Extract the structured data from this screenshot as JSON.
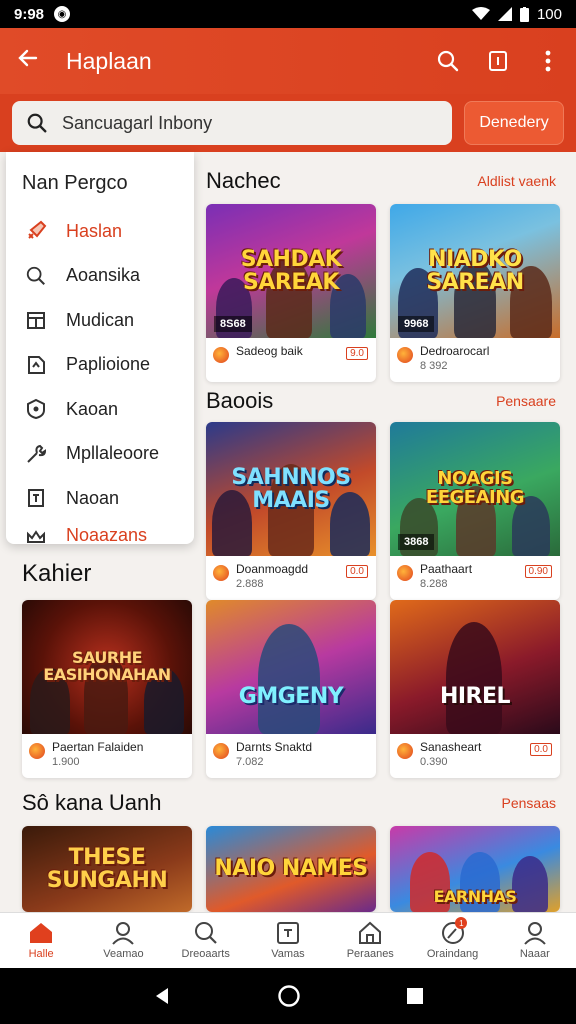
{
  "status": {
    "time": "9:98",
    "battery": "100"
  },
  "appbar": {
    "title": "Haplaan"
  },
  "search": {
    "placeholder": "Sancuagarl Inbony",
    "button_label": "Denedery"
  },
  "drawer": {
    "title": "Nan Pergco",
    "items": [
      {
        "label": "Haslan",
        "icon": "rocket-icon",
        "active": true
      },
      {
        "label": "Aoansika",
        "icon": "search-icon"
      },
      {
        "label": "Mudican",
        "icon": "store-icon"
      },
      {
        "label": "Paplioione",
        "icon": "tag-icon"
      },
      {
        "label": "Kaoan",
        "icon": "shield-icon"
      },
      {
        "label": "Mpllaleoore",
        "icon": "wrench-icon"
      },
      {
        "label": "Naoan",
        "icon": "book-icon"
      },
      {
        "label": "Noaazans",
        "icon": "crown-icon"
      }
    ]
  },
  "sections": [
    {
      "title": "Nachec",
      "more": "Aldlist vaenk",
      "cards": [
        {
          "art_title": "SAHDAK SAREAK",
          "badge": "8S68",
          "name": "Sadeog baik",
          "sub": "",
          "tag": "9.0"
        },
        {
          "art_title": "NIADKO SAREAN",
          "badge": "9968",
          "name": "Dedroarocarl",
          "sub": "8 392",
          "tag": ""
        }
      ]
    },
    {
      "title": "Baoois",
      "more": "Pensaare",
      "cards": [
        {
          "art_title": "SAHNNOS MAAIS",
          "badge": "",
          "name": "Doanmoagdd",
          "sub": "2.888",
          "tag": "0.0"
        },
        {
          "art_title": "NOAGIS EEGEAING",
          "badge": "3868",
          "name": "Paathaart",
          "sub": "8.288",
          "tag": "0.90"
        }
      ]
    },
    {
      "title": "Kahier",
      "more": "",
      "cards": [
        {
          "art_title": "SAURHE EASIHONAHAN",
          "badge": "",
          "name": "Paertan Falaiden",
          "sub": "1.900",
          "tag": ""
        },
        {
          "art_title": "GMGENY",
          "badge": "",
          "name": "Darnts Snaktd",
          "sub": "7.082",
          "tag": ""
        },
        {
          "art_title": "HIREL",
          "badge": "",
          "name": "Sanasheart",
          "sub": "0.390",
          "tag": "0.0"
        }
      ]
    },
    {
      "title": "Sô kana Uanh",
      "more": "Pensaas",
      "cards": [
        {
          "art_title": "THESE SUNGAHN",
          "badge": "",
          "name": "",
          "sub": "",
          "tag": ""
        },
        {
          "art_title": "NAIO NAMES",
          "badge": "",
          "name": "",
          "sub": "",
          "tag": ""
        },
        {
          "art_title": "EARNHAS",
          "badge": "",
          "name": "",
          "sub": "",
          "tag": ""
        }
      ]
    }
  ],
  "bottom_nav": [
    {
      "label": "Halle",
      "icon": "home-icon",
      "active": true
    },
    {
      "label": "Veamao",
      "icon": "profile-icon"
    },
    {
      "label": "Dreoaarts",
      "icon": "search-icon"
    },
    {
      "label": "Vamas",
      "icon": "gamepad-icon"
    },
    {
      "label": "Peraanes",
      "icon": "house-icon"
    },
    {
      "label": "Oraindang",
      "icon": "explore-icon",
      "badge": "1"
    },
    {
      "label": "Naaar",
      "icon": "user-icon"
    }
  ],
  "colors": {
    "primary": "#d9401f",
    "accent": "#ec5a33",
    "background": "#f4f1ee"
  }
}
